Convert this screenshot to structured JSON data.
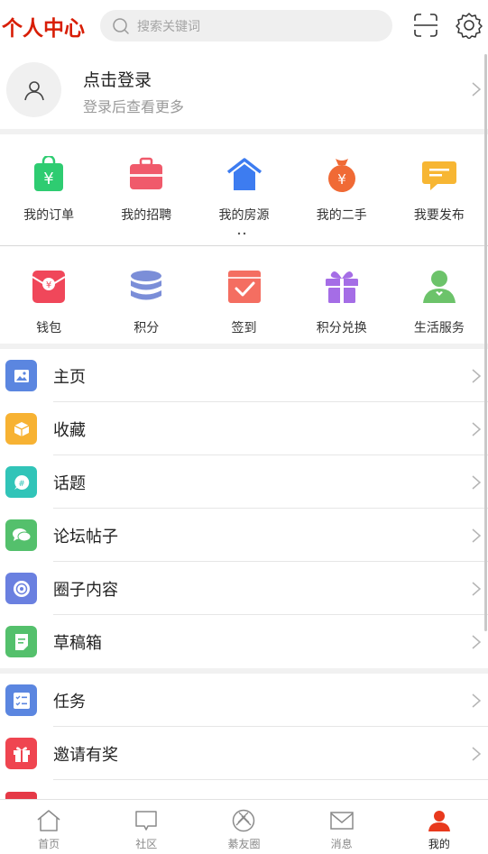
{
  "header": {
    "title": "个人中心",
    "search_placeholder": "搜索关键词",
    "scan_icon": "scan-icon",
    "settings_icon": "gear-icon"
  },
  "login": {
    "title": "点击登录",
    "subtitle": "登录后查看更多"
  },
  "grid1": [
    {
      "label": "我的订单",
      "icon": "shopping-bag-icon",
      "color": "#2ecc71"
    },
    {
      "label": "我的招聘",
      "icon": "briefcase-icon",
      "color": "#f05a6b"
    },
    {
      "label": "我的房源",
      "icon": "house-icon",
      "color": "#3d7cf0"
    },
    {
      "label": "我的二手",
      "icon": "money-bag-icon",
      "color": "#f06a35"
    },
    {
      "label": "我要发布",
      "icon": "message-icon",
      "color": "#f7b633"
    }
  ],
  "grid2": [
    {
      "label": "钱包",
      "icon": "wallet-icon",
      "color": "#f0475a"
    },
    {
      "label": "积分",
      "icon": "coins-icon",
      "color": "#7b8ed8"
    },
    {
      "label": "签到",
      "icon": "checkin-icon",
      "color": "#f46e61"
    },
    {
      "label": "积分兑换",
      "icon": "gift-icon",
      "color": "#a56de6"
    },
    {
      "label": "生活服务",
      "icon": "person-icon",
      "color": "#6cc36a"
    }
  ],
  "menu1": [
    {
      "label": "主页",
      "icon": "image-icon",
      "color": "#5b86e0"
    },
    {
      "label": "收藏",
      "icon": "box-icon",
      "color": "#f7b233"
    },
    {
      "label": "话题",
      "icon": "hashtag-icon",
      "color": "#31c4b8"
    },
    {
      "label": "论坛帖子",
      "icon": "chat-bubbles-icon",
      "color": "#54c06c"
    },
    {
      "label": "圈子内容",
      "icon": "circle-icon",
      "color": "#6a80e0"
    },
    {
      "label": "草稿箱",
      "icon": "draft-icon",
      "color": "#54c06c"
    }
  ],
  "menu2": [
    {
      "label": "任务",
      "icon": "task-list-icon",
      "color": "#5b86e0"
    },
    {
      "label": "邀请有奖",
      "icon": "gift-icon",
      "color": "#ef4550"
    }
  ],
  "tabs": [
    {
      "label": "首页",
      "icon": "home-icon",
      "active": false
    },
    {
      "label": "社区",
      "icon": "chat-icon",
      "active": false
    },
    {
      "label": "綦友圈",
      "icon": "aperture-icon",
      "active": false
    },
    {
      "label": "消息",
      "icon": "mail-icon",
      "active": false
    },
    {
      "label": "我的",
      "icon": "user-icon",
      "active": true
    }
  ],
  "colors": {
    "brand": "#d81e06",
    "active_tab": "#e8391d"
  }
}
